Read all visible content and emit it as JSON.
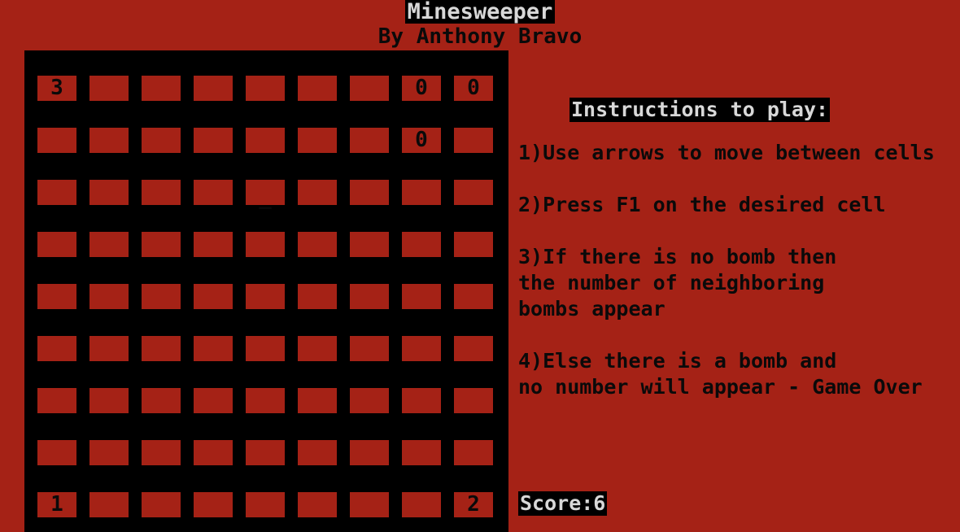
{
  "header": {
    "title": "Minesweeper",
    "subtitle": "By Anthony Bravo"
  },
  "board": {
    "rows": 9,
    "cols": 9,
    "cells": [
      [
        {
          "value": "3",
          "state": "revealed"
        },
        {
          "value": "",
          "state": "hidden"
        },
        {
          "value": "",
          "state": "hidden"
        },
        {
          "value": "",
          "state": "hidden"
        },
        {
          "value": "",
          "state": "hidden"
        },
        {
          "value": "",
          "state": "hidden"
        },
        {
          "value": "",
          "state": "hidden"
        },
        {
          "value": "0",
          "state": "revealed"
        },
        {
          "value": "0",
          "state": "revealed"
        }
      ],
      [
        {
          "value": "",
          "state": "hidden"
        },
        {
          "value": "",
          "state": "hidden"
        },
        {
          "value": "",
          "state": "hidden"
        },
        {
          "value": "",
          "state": "hidden"
        },
        {
          "value": "",
          "state": "hidden"
        },
        {
          "value": "",
          "state": "hidden"
        },
        {
          "value": "",
          "state": "hidden"
        },
        {
          "value": "0",
          "state": "revealed"
        },
        {
          "value": "",
          "state": "hidden"
        }
      ],
      [
        {
          "value": "",
          "state": "hidden"
        },
        {
          "value": "",
          "state": "hidden"
        },
        {
          "value": "",
          "state": "hidden"
        },
        {
          "value": "",
          "state": "hidden"
        },
        {
          "value": "_",
          "state": "cursor"
        },
        {
          "value": "",
          "state": "hidden"
        },
        {
          "value": "",
          "state": "hidden"
        },
        {
          "value": "",
          "state": "hidden"
        },
        {
          "value": "",
          "state": "hidden"
        }
      ],
      [
        {
          "value": "",
          "state": "hidden"
        },
        {
          "value": "",
          "state": "hidden"
        },
        {
          "value": "",
          "state": "hidden"
        },
        {
          "value": "",
          "state": "hidden"
        },
        {
          "value": "",
          "state": "hidden"
        },
        {
          "value": "",
          "state": "hidden"
        },
        {
          "value": "",
          "state": "hidden"
        },
        {
          "value": "",
          "state": "hidden"
        },
        {
          "value": "",
          "state": "hidden"
        }
      ],
      [
        {
          "value": "",
          "state": "hidden"
        },
        {
          "value": "",
          "state": "hidden"
        },
        {
          "value": "",
          "state": "hidden"
        },
        {
          "value": "",
          "state": "hidden"
        },
        {
          "value": "",
          "state": "hidden"
        },
        {
          "value": "",
          "state": "hidden"
        },
        {
          "value": "",
          "state": "hidden"
        },
        {
          "value": "",
          "state": "hidden"
        },
        {
          "value": "",
          "state": "hidden"
        }
      ],
      [
        {
          "value": "",
          "state": "hidden"
        },
        {
          "value": "",
          "state": "hidden"
        },
        {
          "value": "",
          "state": "hidden"
        },
        {
          "value": "",
          "state": "hidden"
        },
        {
          "value": "",
          "state": "hidden"
        },
        {
          "value": "",
          "state": "hidden"
        },
        {
          "value": "",
          "state": "hidden"
        },
        {
          "value": "",
          "state": "hidden"
        },
        {
          "value": "",
          "state": "hidden"
        }
      ],
      [
        {
          "value": "",
          "state": "hidden"
        },
        {
          "value": "",
          "state": "hidden"
        },
        {
          "value": "",
          "state": "hidden"
        },
        {
          "value": "",
          "state": "hidden"
        },
        {
          "value": "",
          "state": "hidden"
        },
        {
          "value": "",
          "state": "hidden"
        },
        {
          "value": "",
          "state": "hidden"
        },
        {
          "value": "",
          "state": "hidden"
        },
        {
          "value": "",
          "state": "hidden"
        }
      ],
      [
        {
          "value": "",
          "state": "hidden"
        },
        {
          "value": "",
          "state": "hidden"
        },
        {
          "value": "",
          "state": "hidden"
        },
        {
          "value": "",
          "state": "hidden"
        },
        {
          "value": "",
          "state": "hidden"
        },
        {
          "value": "",
          "state": "hidden"
        },
        {
          "value": "",
          "state": "hidden"
        },
        {
          "value": "",
          "state": "hidden"
        },
        {
          "value": "",
          "state": "hidden"
        }
      ],
      [
        {
          "value": "1",
          "state": "revealed"
        },
        {
          "value": "",
          "state": "hidden"
        },
        {
          "value": "",
          "state": "hidden"
        },
        {
          "value": "",
          "state": "hidden"
        },
        {
          "value": "",
          "state": "hidden"
        },
        {
          "value": "",
          "state": "hidden"
        },
        {
          "value": "",
          "state": "hidden"
        },
        {
          "value": "",
          "state": "hidden"
        },
        {
          "value": "2",
          "state": "revealed"
        }
      ]
    ]
  },
  "instructions": {
    "heading": "Instructions to play:",
    "items": [
      [
        "1)Use arrows to move between cells"
      ],
      [
        "2)Press F1 on the desired cell"
      ],
      [
        "3)If there is no bomb then",
        "the number of neighboring",
        "bombs appear"
      ],
      [
        "4)Else there is a bomb and",
        "no number will appear - Game Over"
      ]
    ]
  },
  "score": {
    "label": "Score:6"
  },
  "colors": {
    "background": "#a52216",
    "board": "#000000",
    "text_dark": "#0a0a0a",
    "text_light": "#d8d8d8"
  }
}
